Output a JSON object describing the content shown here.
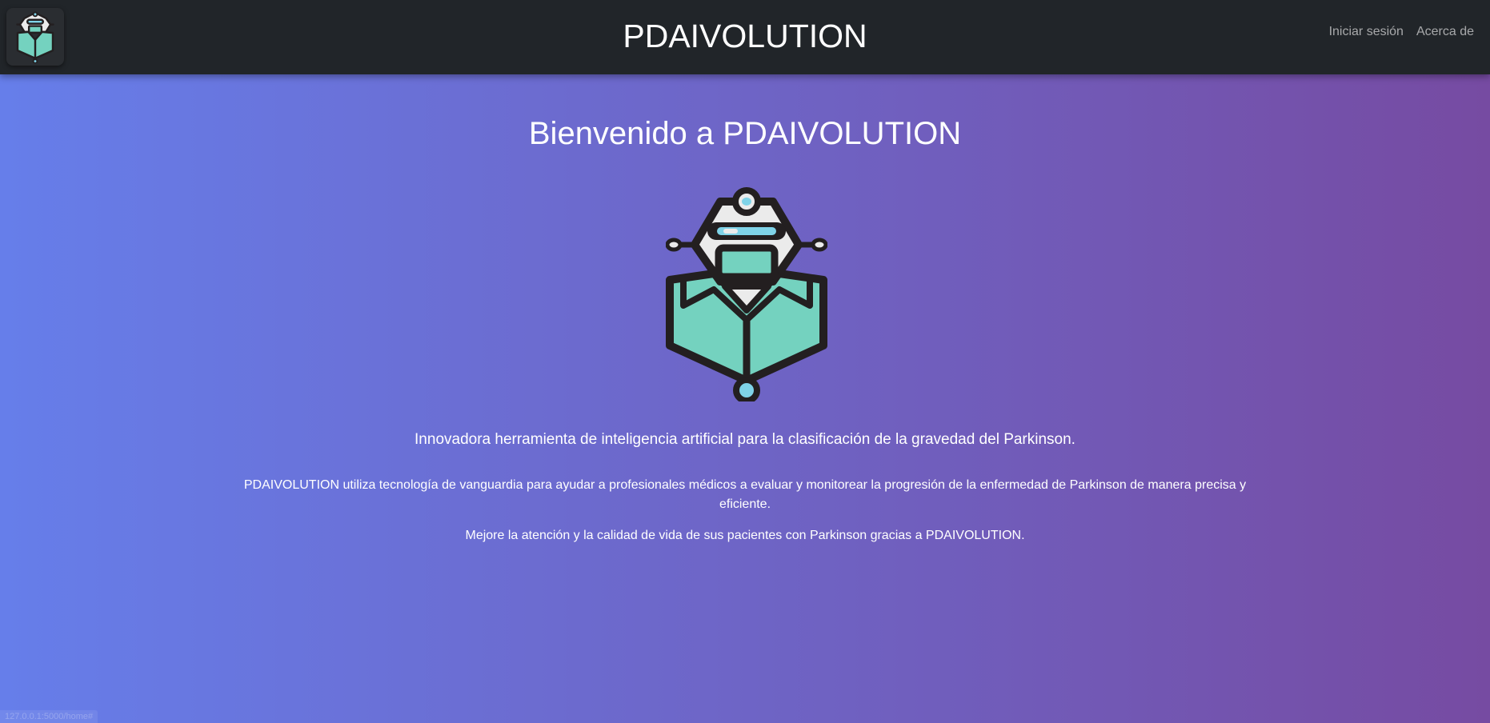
{
  "navbar": {
    "logo_icon": "robot-logo-icon",
    "title": "PDAIVOLUTION",
    "links": [
      {
        "label": "Iniciar sesión"
      },
      {
        "label": "Acerca de"
      }
    ]
  },
  "hero": {
    "title": "Bienvenido a PDAIVOLUTION",
    "logo_icon": "robot-logo-icon",
    "tagline": "Innovadora herramienta de inteligencia artificial para la clasificación de la gravedad del Parkinson.",
    "description": "PDAIVOLUTION utiliza tecnología de vanguardia para ayudar a profesionales médicos a evaluar y monitorear la progresión de la enfermedad de Parkinson de manera precisa y eficiente.",
    "description2": "Mejore la atención y la calidad de vida de sus pacientes con Parkinson gracias a PDAIVOLUTION."
  },
  "status_bar": {
    "url": "127.0.0.1:5000/home#"
  },
  "colors": {
    "navbar_bg": "#212529",
    "gradient_start": "#667eea",
    "gradient_end": "#764ba2",
    "robot_teal": "#74d2bf",
    "robot_light_blue": "#7fd3e8",
    "robot_outline": "#231f20"
  }
}
